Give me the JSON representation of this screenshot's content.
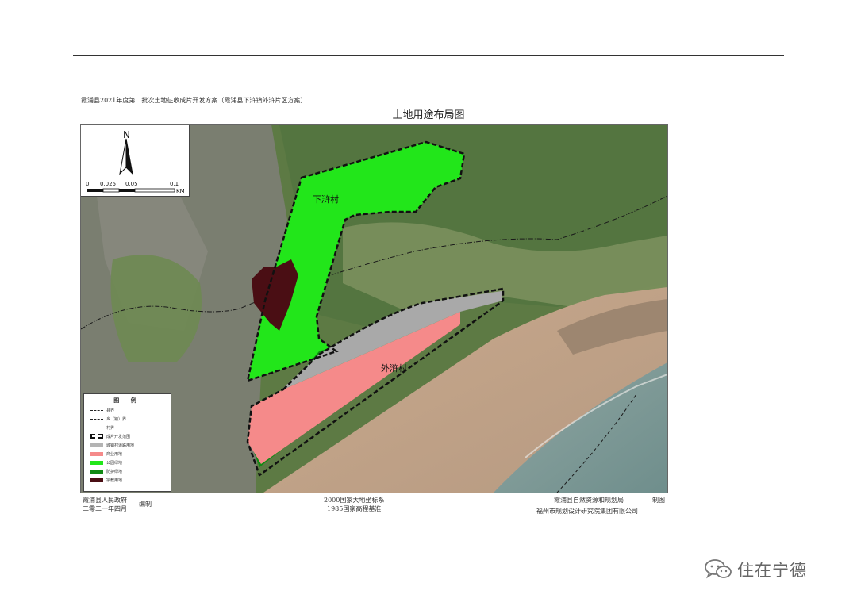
{
  "document": {
    "subtitle": "霞浦县2021年度第二批次土地征收成片开发方案（霞浦县下浒镇外浒片区方案）",
    "title": "土地用途布局图"
  },
  "map": {
    "north_label": "N",
    "scale": {
      "ticks": [
        "0",
        "0.025",
        "0.05",
        "0.1"
      ],
      "unit": "KM"
    },
    "villages": {
      "upper": "下浒村",
      "lower": "外浒村"
    },
    "legend": {
      "title": "图 例",
      "items": [
        {
          "label": "县界",
          "kind": "line",
          "style": "dash-dot",
          "color": "#222222"
        },
        {
          "label": "乡（镇）界",
          "kind": "line",
          "style": "long-dash-dot",
          "color": "#222222"
        },
        {
          "label": "村界",
          "kind": "line",
          "style": "dash",
          "color": "#444444"
        },
        {
          "label": "成片开发范围",
          "kind": "boundary",
          "style": "bold-dash",
          "color": "#111111"
        },
        {
          "label": "城镇村道路用地",
          "kind": "fill",
          "color": "#b4b4b4"
        },
        {
          "label": "商业用地",
          "kind": "fill",
          "color": "#f58a8a"
        },
        {
          "label": "公园绿地",
          "kind": "fill",
          "color": "#22e61a"
        },
        {
          "label": "防护绿地",
          "kind": "fill",
          "color": "#118a14"
        },
        {
          "label": "宗教用地",
          "kind": "fill",
          "color": "#4a0e14"
        }
      ]
    },
    "colors": {
      "park_green": "#22e61a",
      "protective_green": "#118a14",
      "commercial": "#f58a8a",
      "road": "#a9a9a9",
      "religious": "#4a0e14",
      "boundary": "#111111"
    }
  },
  "footer": {
    "left_org": "霞浦县人民政府",
    "left_date": "二零二一年四月",
    "left_role": "编制",
    "center_line1": "2000国家大地坐标系",
    "center_line2": "1985国家高程基准",
    "right_org1": "霞浦县自然资源和规划局",
    "right_role": "制图",
    "right_org2": "福州市规划设计研究院集团有限公司"
  },
  "watermark": {
    "text": "住在宁德",
    "icon": "wechat-icon"
  }
}
